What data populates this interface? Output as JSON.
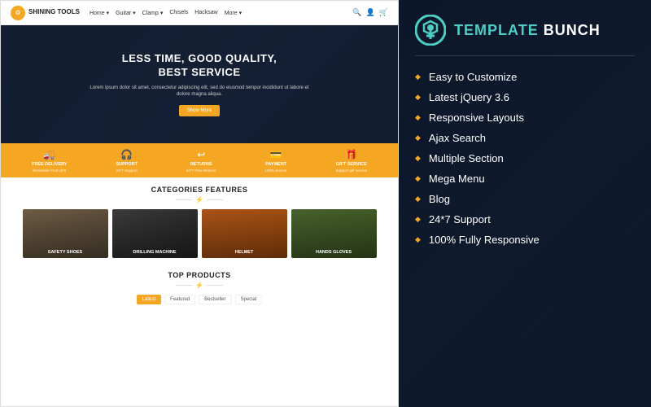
{
  "left": {
    "navbar": {
      "logo_name": "SHINING\nTOOLS",
      "nav_items": [
        "Home",
        "Guitar",
        "Clamp",
        "Chisels",
        "Hacksaw",
        "More"
      ],
      "nav_icon_search": "🔍",
      "nav_icon_user": "👤",
      "nav_icon_cart": "🛒"
    },
    "hero": {
      "title": "LESS TIME, GOOD QUALITY,\nBEST SERVICE",
      "description": "Lorem ipsum dolor sit amet, consectetur adipiscing elit, sed do eiusmod tempor incididunt ut labore et dolore magna aliqua.",
      "cta_label": "Show More"
    },
    "features_bar": [
      {
        "icon": "🚚",
        "label": "FREE DELIVERY",
        "sub": "Worldwide From $75"
      },
      {
        "icon": "🎧",
        "label": "SUPPORT",
        "sub": "24*7 Support"
      },
      {
        "icon": "↩",
        "label": "RETURNS",
        "sub": "24*7 Free Returns"
      },
      {
        "icon": "💳",
        "label": "PAYMENT",
        "sub": "100% Secure"
      },
      {
        "icon": "🎁",
        "label": "GIFT SERVICE",
        "sub": "Support gift service"
      }
    ],
    "categories": {
      "title": "CATEGORIES FEATURES",
      "items": [
        {
          "label": "SAFETY SHOES",
          "color": "shoes"
        },
        {
          "label": "DRILLING MACHINE",
          "color": "drill"
        },
        {
          "label": "HELMET",
          "color": "helmet"
        },
        {
          "label": "HANDS GLOVES",
          "color": "gloves"
        }
      ]
    },
    "products": {
      "title": "TOP PRODUCTS",
      "tabs": [
        "Latest",
        "Featured",
        "Bestseller",
        "Special"
      ]
    }
  },
  "right": {
    "brand": {
      "name_part1": "teMpLATe",
      "name_part2": "BUNCH",
      "logo_color": "#4ecdc4"
    },
    "features": [
      "Easy to Customize",
      "Latest jQuery 3.6",
      "Responsive Layouts",
      "Ajax Search",
      "Multiple Section",
      "Mega Menu",
      "Blog",
      "24*7 Support",
      "100% Fully Responsive"
    ]
  }
}
